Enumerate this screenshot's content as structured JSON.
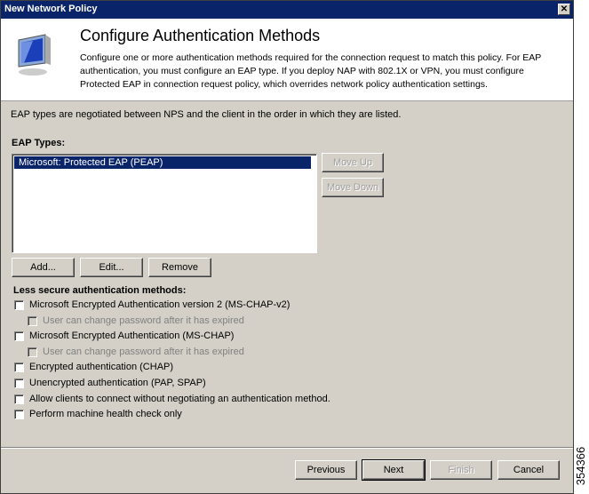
{
  "window": {
    "title": "New Network Policy",
    "close": "✕"
  },
  "header": {
    "title": "Configure Authentication Methods",
    "description": "Configure one or more authentication methods required for the connection request to match this policy. For EAP authentication, you must configure an EAP type. If you deploy NAP with 802.1X or VPN, you must configure Protected EAP in connection request policy, which overrides network policy authentication settings."
  },
  "intro": "EAP types are negotiated between NPS and the client in the order in which they are listed.",
  "eap": {
    "label": "EAP Types:",
    "items": [
      "Microsoft: Protected EAP (PEAP)"
    ],
    "move_up": "Move Up",
    "move_down": "Move Down",
    "add": "Add...",
    "edit": "Edit...",
    "remove": "Remove"
  },
  "less_secure": {
    "label": "Less secure authentication methods:",
    "options": [
      {
        "label": "Microsoft Encrypted Authentication version 2 (MS-CHAP-v2)",
        "checked": false
      },
      {
        "label": "User can change password after it has expired",
        "checked": false,
        "disabled": true
      },
      {
        "label": "Microsoft Encrypted Authentication (MS-CHAP)",
        "checked": false
      },
      {
        "label": "User can change password after it has expired",
        "checked": false,
        "disabled": true
      },
      {
        "label": "Encrypted authentication (CHAP)",
        "checked": false
      },
      {
        "label": "Unencrypted authentication (PAP, SPAP)",
        "checked": false
      },
      {
        "label": "Allow clients to connect without negotiating an authentication method.",
        "checked": false
      },
      {
        "label": "Perform machine health check only",
        "checked": false
      }
    ]
  },
  "footer": {
    "previous": "Previous",
    "next": "Next",
    "finish": "Finish",
    "cancel": "Cancel"
  },
  "figure_id": "354366"
}
